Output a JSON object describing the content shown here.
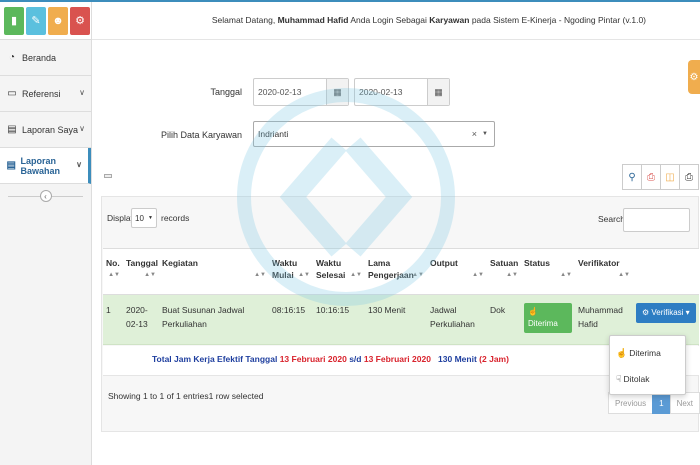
{
  "header": {
    "welcome_prefix": "Selamat Datang,",
    "user_name": "Muhammad Hafid",
    "mid_text": "Anda Login Sebagai",
    "role": "Karyawan",
    "suffix": "pada Sistem E-Kinerja - Ngoding Pintar (v.1.0)"
  },
  "sidebar": {
    "items": [
      {
        "label": "Beranda",
        "icon": "dashboard-icon"
      },
      {
        "label": "Referensi",
        "icon": "desktop-icon"
      },
      {
        "label": "Laporan Saya",
        "icon": "book-icon"
      },
      {
        "label": "Laporan Bawahan",
        "icon": "book-icon"
      }
    ]
  },
  "filter": {
    "tanggal_label": "Tanggal",
    "date_from": "2020-02-13",
    "date_to": "2020-02-13",
    "karyawan_label": "Pilih Data Karyawan",
    "karyawan_value": "Indrianti",
    "clear_glyph": "×"
  },
  "table": {
    "display_label": "Display",
    "length_value": "10",
    "records_label": "records",
    "search_label": "Search:",
    "columns": [
      "No.",
      "Tanggal",
      "Kegiatan",
      "Waktu Mulai",
      "Waktu Selesai",
      "Lama Pengerjaan",
      "Output",
      "Satuan",
      "Status",
      "Verifikator",
      ""
    ],
    "rows": [
      {
        "no": "1",
        "tanggal": "2020-02-13",
        "kegiatan": "Buat Susunan Jadwal Perkuliahan",
        "mulai": "08:16:15",
        "selesai": "10:16:15",
        "lama": "130 Menit",
        "output": "Jadwal Perkuliahan",
        "satuan": "Dok",
        "status": "Diterima",
        "verifikator": "Muhammad Hafid",
        "action": "Verifikasi"
      }
    ],
    "total": {
      "prefix": "Total Jam Kerja Efektif Tanggal",
      "date_from": "13 Februari 2020",
      "sd": "s/d",
      "date_to": "13 Februari 2020",
      "minutes": "130 Menit",
      "hours": "(2 Jam)"
    },
    "dropdown": [
      "Diterima",
      "Ditolak"
    ],
    "info": "Showing 1 to 1 of 1 entries1 row selected",
    "pager": {
      "prev": "Previous",
      "current": "1",
      "next": "Next"
    }
  }
}
